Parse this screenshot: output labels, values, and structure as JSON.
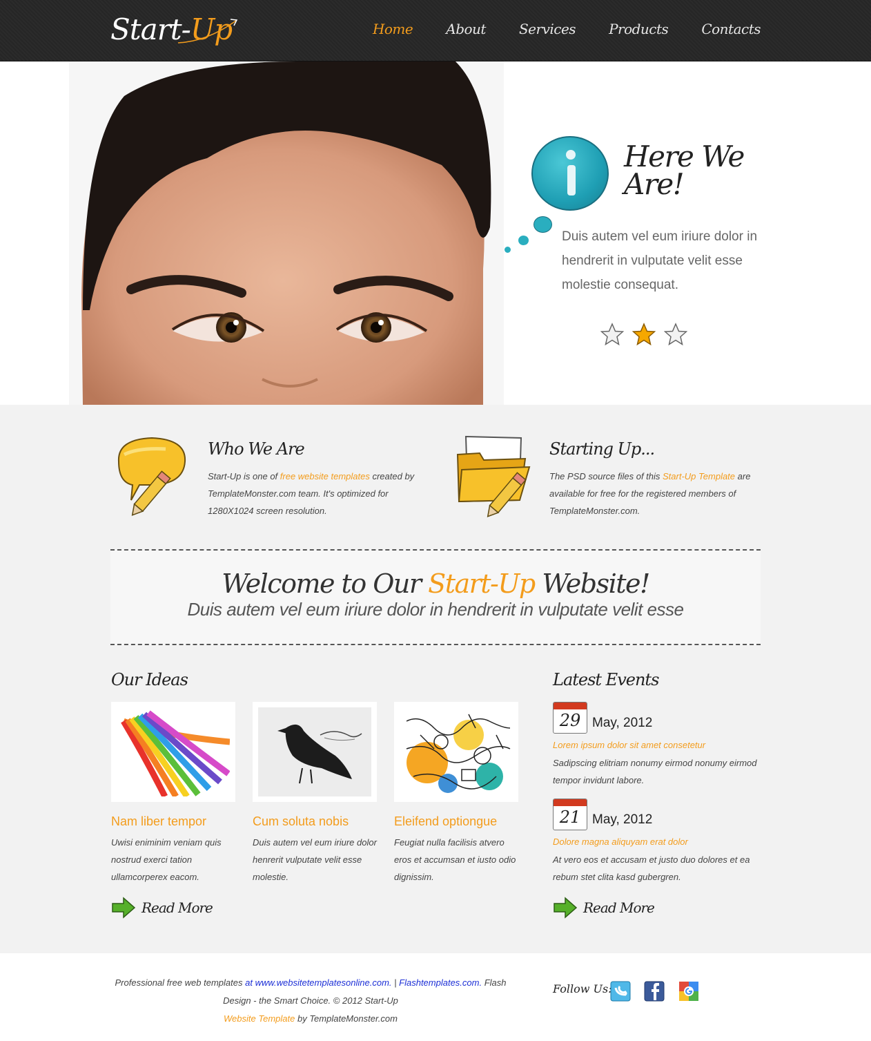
{
  "header": {
    "logo_main": "Start-",
    "logo_accent": "Up",
    "nav": [
      "Home",
      "About",
      "Services",
      "Products",
      "Contacts"
    ],
    "active_nav": "Home"
  },
  "hero": {
    "title": "Here We Are!",
    "text": "Duis autem vel eum iriure dolor in hendrerit in vulputate velit esse molestie consequat.",
    "rating": {
      "selected": 2,
      "total": 3
    }
  },
  "features": [
    {
      "title": "Who We Are",
      "text_before": "Start-Up is one of ",
      "link": "free website templates",
      "text_after": " created by TemplateMonster.com team. It's optimized for 1280X1024 screen resolution.",
      "icon": "speech-bubble-pencil-icon"
    },
    {
      "title": "Starting Up...",
      "text_before": "The PSD source files of this ",
      "link": "Start-Up Template",
      "text_after": " are available for free for the registered members of TemplateMonster.com.",
      "icon": "folder-pencil-icon"
    }
  ],
  "welcome": {
    "title_before": "Welcome to Our ",
    "title_accent": "Start-Up",
    "title_after": " Website!",
    "subtitle": "Duis autem vel eum iriure dolor in hendrerit in vulputate velit esse"
  },
  "ideas": {
    "title": "Our Ideas",
    "items": [
      {
        "title": "Nam liber tempor",
        "text": "Uwisi eniminim veniam quis nostrud exerci tation ullamcorperex eacom.",
        "image": "rainbow-image"
      },
      {
        "title": "Cum soluta nobis",
        "text": "Duis autem vel eum iriure dolor henrerit vulputate velit esse molestie.",
        "image": "crow-sketch-image"
      },
      {
        "title": "Eleifend optiongue",
        "text": "Feugiat nulla facilisis atvero eros et accumsan et iusto odio dignissim.",
        "image": "doodle-art-image"
      }
    ],
    "read_more": "Read More"
  },
  "events": {
    "title": "Latest Events",
    "items": [
      {
        "day": "29",
        "date": "May, 2012",
        "title": "Lorem ipsum dolor sit amet consetetur",
        "text": "Sadipscing elitriam nonumy eirmod nonumy eirmod tempor invidunt labore."
      },
      {
        "day": "21",
        "date": "May, 2012",
        "title": "Dolore magna aliquyam erat dolor",
        "text": "At vero eos et accusam et justo duo dolores et ea rebum stet clita kasd gubergren."
      }
    ],
    "read_more": "Read More"
  },
  "footer": {
    "line1_a": "Professional free web templates ",
    "line1_b": "at www.websitetemplatesonline.com.",
    "line1_c": " | ",
    "line1_d": "Flashtemplates.com.",
    "line1_e": " Flash Design - the Smart Choice. © 2012 Start-Up ",
    "line2_a": "Website Template",
    "line2_b": " by TemplateMonster.com",
    "follow": "Follow Us:",
    "social": [
      "twitter-icon",
      "facebook-icon",
      "google-icon"
    ]
  },
  "colors": {
    "accent": "#f39c1c",
    "header_bg": "#2b2b2b",
    "link_blue": "#1c2fd6",
    "bubble": "#1f9fb4"
  }
}
